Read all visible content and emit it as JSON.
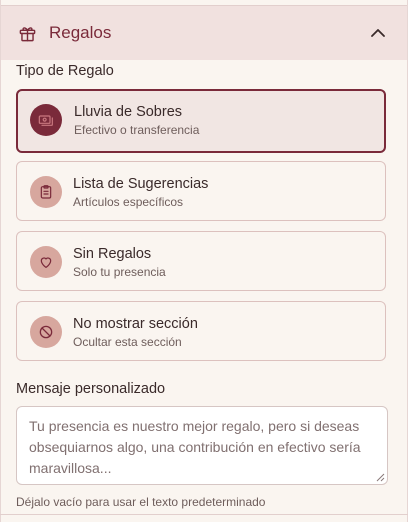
{
  "header": {
    "title": "Regalos",
    "icon": "gift-icon",
    "collapse_icon": "chevron-up-icon"
  },
  "section_label": "Tipo de Regalo",
  "options": [
    {
      "name": "Lluvia de Sobres",
      "sub": "Efectivo o transferencia",
      "icon": "money-icon",
      "selected": true
    },
    {
      "name": "Lista de Sugerencias",
      "sub": "Artículos específicos",
      "icon": "clipboard-icon",
      "selected": false
    },
    {
      "name": "Sin Regalos",
      "sub": "Solo tu presencia",
      "icon": "heart-icon",
      "selected": false
    },
    {
      "name": "No mostrar sección",
      "sub": "Ocultar esta sección",
      "icon": "ban-icon",
      "selected": false
    }
  ],
  "message": {
    "label": "Mensaje personalizado",
    "placeholder": "Tu presencia es nuestro mejor regalo, pero si deseas obsequiarnos algo, una contribución en efectivo sería maravillosa...",
    "help": "Déjalo vacío para usar el texto predeterminado"
  },
  "colors": {
    "accent": "#7a2a3a",
    "icon_bg": "#d7a79e",
    "header_bg": "#f1e1df",
    "page_bg": "#faf5f0"
  }
}
